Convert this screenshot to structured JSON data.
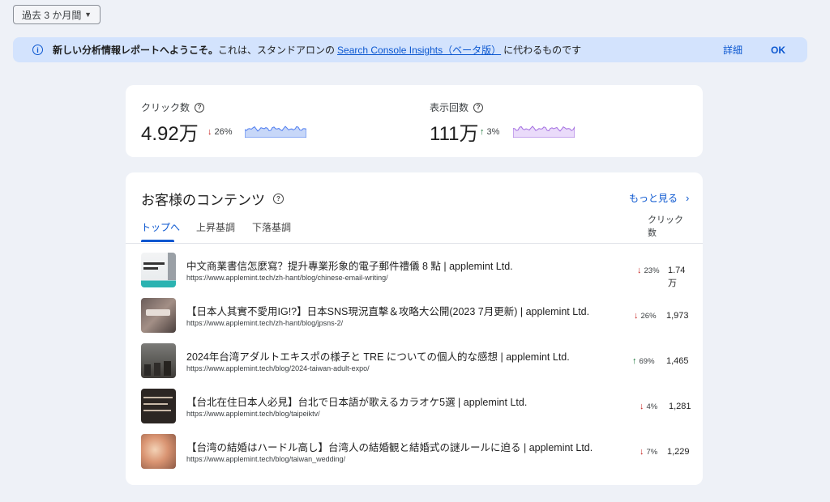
{
  "date_range": "過去 3 か月間",
  "banner": {
    "bold_text": "新しい分析情報レポートへようこそ。",
    "text_before_link": "これは、スタンドアロンの",
    "link": "Search Console Insights（ベータ版）",
    "text_after_link": "に代わるものです",
    "detail_label": "詳細",
    "ok_label": "OK"
  },
  "metrics": {
    "clicks": {
      "label": "クリック数",
      "value": "4.92万",
      "change": "26%",
      "direction": "down",
      "color": "#4f7df0"
    },
    "impressions": {
      "label": "表示回数",
      "value": "111万",
      "change": "3%",
      "direction": "up",
      "color": "#a36ee0"
    }
  },
  "content": {
    "title": "お客様のコンテンツ",
    "more_label": "もっと見る",
    "tabs": [
      "トップへ",
      "上昇基調",
      "下落基調"
    ],
    "column_header_line1": "クリック",
    "column_header_line2": "数",
    "rows": [
      {
        "title": "中文商業書信怎麼寫？提升專業形象的電子郵件禮儀 8 點 | applemint Ltd.",
        "url": "https://www.applemint.tech/zh-hant/blog/chinese-email-writing/",
        "change": "23%",
        "direction": "down",
        "clicks_line1": "1.74",
        "clicks_line2": "万"
      },
      {
        "title": "【日本人其實不愛用IG!?】日本SNS現況直擊＆攻略大公開(2023 7月更新) | applemint Ltd.",
        "url": "https://www.applemint.tech/zh-hant/blog/jpsns-2/",
        "change": "26%",
        "direction": "down",
        "clicks_line1": "1,973",
        "clicks_line2": ""
      },
      {
        "title": "2024年台湾アダルトエキスポの様子と TRE についての個人的な感想 | applemint Ltd.",
        "url": "https://www.applemint.tech/blog/2024-taiwan-adult-expo/",
        "change": "69%",
        "direction": "up",
        "clicks_line1": "1,465",
        "clicks_line2": ""
      },
      {
        "title": "【台北在住日本人必見】台北で日本語が歌えるカラオケ5選 | applemint Ltd.",
        "url": "https://www.applemint.tech/blog/taipeiktv/",
        "change": "4%",
        "direction": "down",
        "clicks_line1": "1,281",
        "clicks_line2": ""
      },
      {
        "title": "【台湾の結婚はハードル高し】台湾人の結婚観と結婚式の謎ルールに迫る | applemint Ltd.",
        "url": "https://www.applemint.tech/blog/taiwan_wedding/",
        "change": "7%",
        "direction": "down",
        "clicks_line1": "1,229",
        "clicks_line2": ""
      }
    ]
  }
}
